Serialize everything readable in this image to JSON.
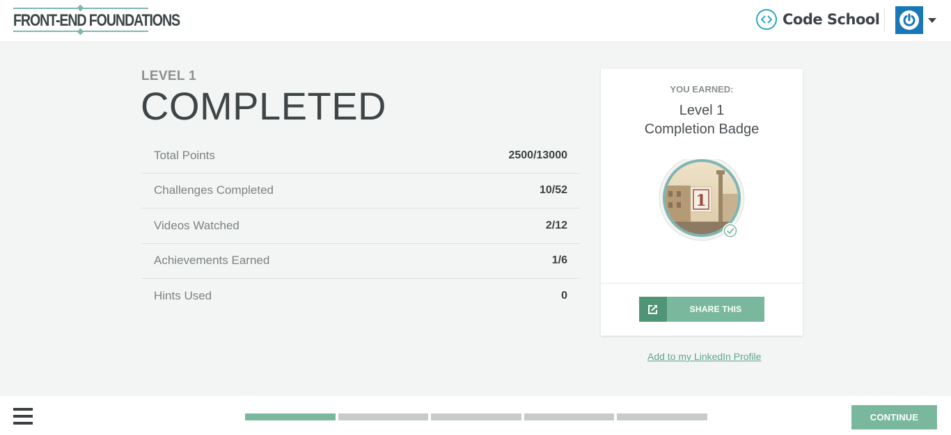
{
  "header": {
    "course_title": "FRONT-END FOUNDATIONS",
    "brand_name": "Code School",
    "colors": {
      "brand": "#2aa6c3",
      "avatar": "#1877b6"
    }
  },
  "summary": {
    "level_label": "LEVEL 1",
    "status_title": "COMPLETED",
    "stats": [
      {
        "label": "Total Points",
        "value": "2500/13000"
      },
      {
        "label": "Challenges Completed",
        "value": "10/52"
      },
      {
        "label": "Videos Watched",
        "value": "2/12"
      },
      {
        "label": "Achievements Earned",
        "value": "1/6"
      },
      {
        "label": "Hints Used",
        "value": "0"
      }
    ]
  },
  "badge_card": {
    "earned_label": "YOU EARNED:",
    "title_line1": "Level 1",
    "title_line2": "Completion Badge",
    "badge_number": "1",
    "share_label": "SHARE THIS",
    "linkedin_label": "Add to my LinkedIn Profile"
  },
  "footer": {
    "continue_label": "CONTINUE",
    "progress_segments": 5,
    "progress_completed": 1,
    "accent_color": "#7ab89e"
  }
}
